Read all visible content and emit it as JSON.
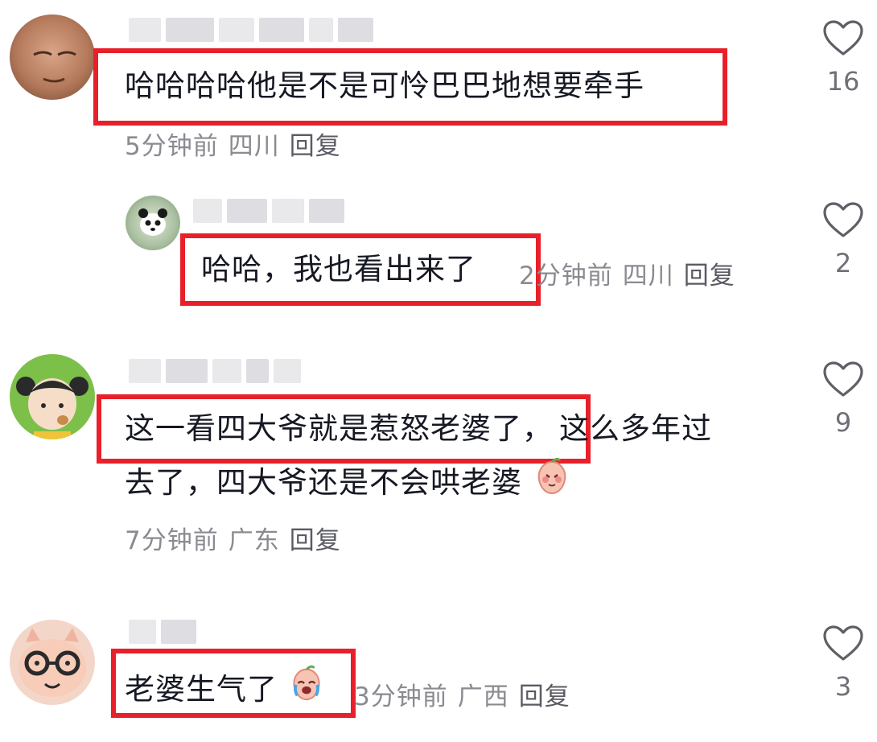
{
  "comments": [
    {
      "text": "哈哈哈哈他是不是可怜巴巴地想要牵手",
      "time": "5分钟前",
      "location": "四川",
      "reply": "回复",
      "likes": "16",
      "avatar": "blurred-face-avatar"
    },
    {
      "text": "哈哈，我也看出来了",
      "time": "2分钟前",
      "location": "四川",
      "reply": "回复",
      "likes": "2",
      "avatar": "panda-avatar"
    },
    {
      "text_line1_highlight": "这一看四大爷就是惹怒老婆了，",
      "text_line1_rest": "这么多年过",
      "text_line2": "去了，四大爷还是不会哄老婆",
      "time": "7分钟前",
      "location": "广东",
      "reply": "回复",
      "likes": "9",
      "avatar": "cartoon-girl-avatar",
      "emoji": "shy-peach-emoji"
    },
    {
      "text": "老婆生气了",
      "time": "3分钟前",
      "location": "广西",
      "reply": "回复",
      "likes": "3",
      "avatar": "glasses-pig-avatar",
      "emoji": "crying-peach-emoji"
    }
  ],
  "colors": {
    "highlight": "#e8202a",
    "meta": "#8a8b91",
    "text": "#161823"
  }
}
